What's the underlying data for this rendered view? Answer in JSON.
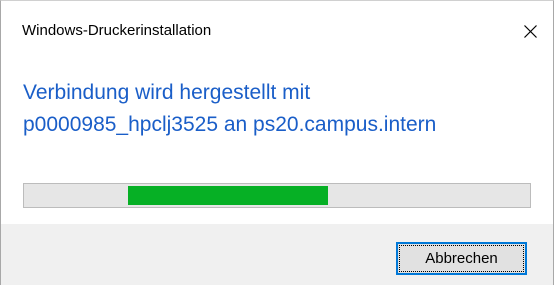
{
  "window": {
    "title": "Windows-Druckerinstallation",
    "close_icon": "close-icon"
  },
  "message": {
    "line1": "Verbindung wird hergestellt mit",
    "line2": "p0000985_hpclj3525 an ps20.campus.intern"
  },
  "progress": {
    "style": "marquee",
    "fill_color": "#06b025"
  },
  "footer": {
    "cancel_label": "Abbrechen"
  },
  "colors": {
    "message_text": "#1a5ec8",
    "button_border": "#0078d7",
    "footer_bg": "#f0f0f0"
  }
}
